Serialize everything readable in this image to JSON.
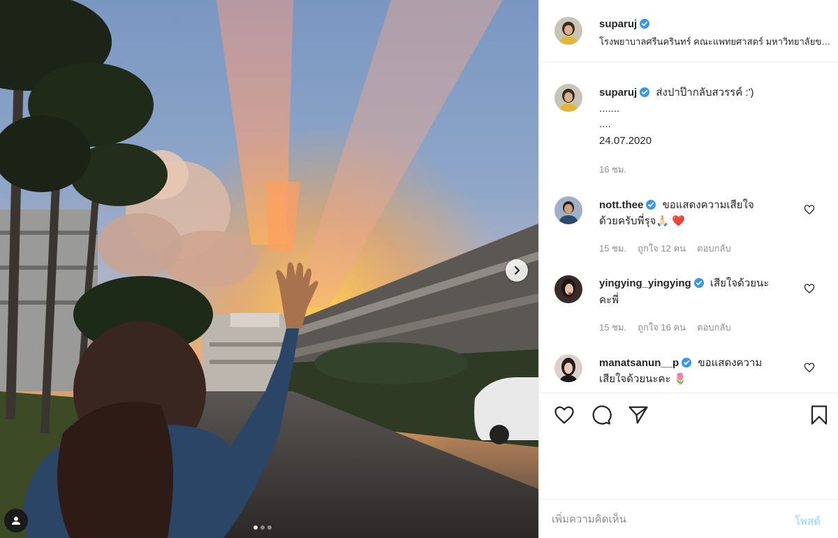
{
  "post": {
    "author": "suparuj",
    "location": "โรงพยาบาลศรีนครินทร์ คณะแพทยศาสตร์ มหาวิทยาลัยขอนแก่น",
    "carousel": {
      "total_images": 3,
      "current_image": 1
    }
  },
  "caption": {
    "username": "suparuj",
    "lines": [
      "ส่งปาป๊ากลับสวรรค์ :')",
      ".......",
      "....",
      "24.07.2020"
    ],
    "time": "16 ชม."
  },
  "comments": [
    {
      "username": "nott.thee",
      "text_line1": "ขอแสดงความเสียใจ",
      "text_line2": "ด้วยครับพี่รุจ🙏🏻 ❤️",
      "time": "15 ชม.",
      "likes": "ถูกใจ 12 คน",
      "reply": "ตอบกลับ"
    },
    {
      "username": "yingying_yingying",
      "text_line1": "เสียใจด้วยนะ",
      "text_line2": "คะพี่",
      "time": "15 ชม.",
      "likes": "ถูกใจ 16 คน",
      "reply": "ตอบกลับ"
    },
    {
      "username": "manatsanun__p",
      "text_line1": "ขอแสดงความ",
      "text_line2": "เสียใจด้วยนะคะ 🌷",
      "time": "",
      "likes": "",
      "reply": ""
    }
  ],
  "add_comment": {
    "placeholder": "เพิ่มความคิดเห็น",
    "post_label": "โพสต์"
  },
  "icons": {
    "verified": "verified-badge-icon",
    "like": "heart-icon",
    "comment": "comment-bubble-icon",
    "share": "paper-plane-icon",
    "save": "bookmark-icon",
    "next": "chevron-right-icon",
    "tag": "user-tag-icon"
  },
  "colors": {
    "verified_blue": "#3897f0",
    "muted_text": "#8e8e8e",
    "post_button_disabled": "#b2dffc",
    "border": "#efefef"
  }
}
